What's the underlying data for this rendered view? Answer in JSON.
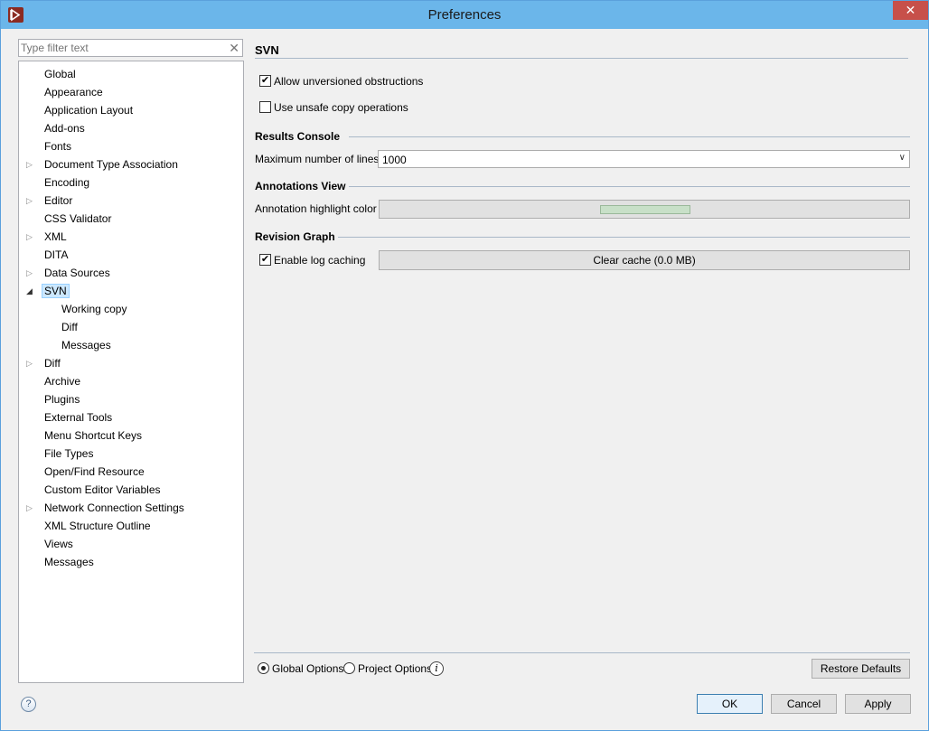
{
  "window": {
    "title": "Preferences"
  },
  "filter": {
    "placeholder": "Type filter text"
  },
  "tree": [
    {
      "label": "Global",
      "expand": ""
    },
    {
      "label": "Appearance",
      "expand": ""
    },
    {
      "label": "Application Layout",
      "expand": ""
    },
    {
      "label": "Add-ons",
      "expand": ""
    },
    {
      "label": "Fonts",
      "expand": ""
    },
    {
      "label": "Document Type Association",
      "expand": "collapsed"
    },
    {
      "label": "Encoding",
      "expand": ""
    },
    {
      "label": "Editor",
      "expand": "collapsed"
    },
    {
      "label": "CSS Validator",
      "expand": ""
    },
    {
      "label": "XML",
      "expand": "collapsed"
    },
    {
      "label": "DITA",
      "expand": ""
    },
    {
      "label": "Data Sources",
      "expand": "collapsed"
    },
    {
      "label": "SVN",
      "expand": "expanded",
      "selected": true
    },
    {
      "label": "Working copy",
      "expand": "",
      "child": true
    },
    {
      "label": "Diff",
      "expand": "",
      "child": true
    },
    {
      "label": "Messages",
      "expand": "",
      "child": true
    },
    {
      "label": "Diff",
      "expand": "collapsed"
    },
    {
      "label": "Archive",
      "expand": ""
    },
    {
      "label": "Plugins",
      "expand": ""
    },
    {
      "label": "External Tools",
      "expand": ""
    },
    {
      "label": "Menu Shortcut Keys",
      "expand": ""
    },
    {
      "label": "File Types",
      "expand": ""
    },
    {
      "label": "Open/Find Resource",
      "expand": ""
    },
    {
      "label": "Custom Editor Variables",
      "expand": ""
    },
    {
      "label": "Network Connection Settings",
      "expand": "collapsed"
    },
    {
      "label": "XML Structure Outline",
      "expand": ""
    },
    {
      "label": "Views",
      "expand": ""
    },
    {
      "label": "Messages",
      "expand": ""
    }
  ],
  "page": {
    "title": "SVN",
    "allow_unversioned": {
      "label": "Allow unversioned obstructions",
      "checked": true
    },
    "unsafe_copy": {
      "label": "Use unsafe copy operations",
      "checked": false
    },
    "results_console": {
      "title": "Results Console",
      "max_lines_label": "Maximum number of lines",
      "max_lines_value": "1000"
    },
    "annotations_view": {
      "title": "Annotations View",
      "highlight_label": "Annotation highlight color",
      "highlight_color": "#c8e0c8"
    },
    "revision_graph": {
      "title": "Revision Graph",
      "log_caching_label": "Enable log caching",
      "log_caching_checked": true,
      "clear_cache_label": "Clear cache (0.0 MB)"
    }
  },
  "options": {
    "global_label": "Global Options",
    "project_label": "Project Options",
    "selected": "global",
    "restore_defaults": "Restore Defaults"
  },
  "footer": {
    "ok": "OK",
    "cancel": "Cancel",
    "apply": "Apply",
    "help": "?"
  },
  "colors": {
    "titlebar": "#6bb6ea",
    "close": "#c7504a",
    "selection": "#cce8ff"
  }
}
